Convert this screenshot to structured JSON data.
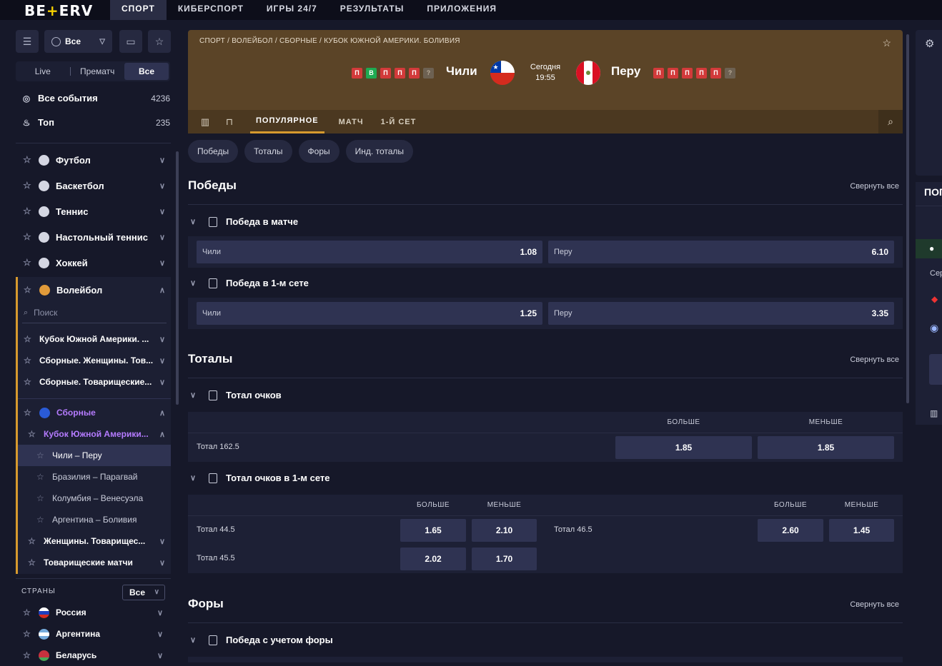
{
  "topbar": {
    "logo": "BETERV",
    "tabs": [
      "СПОРТ",
      "КИБЕРСПОРТ",
      "ИГРЫ 24/7",
      "РЕЗУЛЬТАТЫ",
      "ПРИЛОЖЕНИЯ"
    ],
    "active_tab": "СПОРТ"
  },
  "sidebar": {
    "filter_select": "Все",
    "modes": [
      "Live",
      "Прематч",
      "Все"
    ],
    "active_mode": "Все",
    "all_events": {
      "label": "Все события",
      "count": "4236"
    },
    "top": {
      "label": "Топ",
      "count": "235"
    },
    "sports": [
      {
        "label": "Футбол",
        "icon": "football-icon"
      },
      {
        "label": "Баскетбол",
        "icon": "basketball-icon"
      },
      {
        "label": "Теннис",
        "icon": "tennis-icon"
      },
      {
        "label": "Настольный теннис",
        "icon": "table-tennis-icon"
      },
      {
        "label": "Хоккей",
        "icon": "hockey-icon"
      }
    ],
    "volleyball": {
      "label": "Волейбол",
      "search_placeholder": "Поиск",
      "leagues": [
        "Кубок Южной Америки. ...",
        "Сборные. Женщины. Тов...",
        "Сборные. Товарищеские..."
      ],
      "national": "Сборные",
      "national_league": "Кубок Южной Америки...",
      "matches": [
        "Чили – Перу",
        "Бразилия – Парагвай",
        "Колумбия – Венесуэла",
        "Аргентина – Боливия"
      ],
      "active_match": "Чили – Перу",
      "more": [
        "Женщины. Товарищес...",
        "Товарищеские матчи"
      ]
    },
    "countries": {
      "title": "СТРАНЫ",
      "filter": "Все",
      "items": [
        "Россия",
        "Аргентина",
        "Беларусь"
      ]
    }
  },
  "match": {
    "breadcrumb": "СПОРТ / ВОЛЕЙБОЛ / СБОРНЫЕ / КУБОК ЮЖНОЙ АМЕРИКИ. БОЛИВИЯ",
    "home": {
      "name": "Чили",
      "form": [
        "П",
        "В",
        "П",
        "П",
        "П",
        "?"
      ]
    },
    "away": {
      "name": "Перу",
      "form": [
        "П",
        "П",
        "П",
        "П",
        "П",
        "?"
      ]
    },
    "day": "Сегодня",
    "time": "19:55",
    "tabs": [
      "ПОПУЛЯРНОЕ",
      "МАТЧ",
      "1-Й СЕТ"
    ],
    "active_tab": "ПОПУЛЯРНОЕ"
  },
  "chips": [
    "Победы",
    "Тоталы",
    "Форы",
    "Инд. тоталы"
  ],
  "collapse_all": "Свернуть все",
  "sections": {
    "wins": {
      "title": "Победы",
      "m1": {
        "title": "Победа в матче",
        "home": "Чили",
        "home_odd": "1.08",
        "away": "Перу",
        "away_odd": "6.10"
      },
      "m2": {
        "title": "Победа в 1-м сете",
        "home": "Чили",
        "home_odd": "1.25",
        "away": "Перу",
        "away_odd": "3.35"
      }
    },
    "totals": {
      "title": "Тоталы",
      "over": "БОЛЬШЕ",
      "under": "МЕНЬШЕ",
      "m1": {
        "title": "Тотал очков",
        "label": "Тотал 162.5",
        "over": "1.85",
        "under": "1.85"
      },
      "m2": {
        "title": "Тотал очков в 1-м сете",
        "rows": [
          {
            "label": "Тотал 44.5",
            "over": "1.65",
            "under": "2.10"
          },
          {
            "label": "Тотал 46.5",
            "over": "2.60",
            "under": "1.45"
          },
          {
            "label": "Тотал 45.5",
            "over": "2.02",
            "under": "1.70"
          }
        ]
      }
    },
    "handicap": {
      "title": "Форы",
      "m1": {
        "title": "Победа с учетом форы"
      }
    }
  },
  "right_panel": {
    "title": "ПОП",
    "ser": "Сер"
  }
}
